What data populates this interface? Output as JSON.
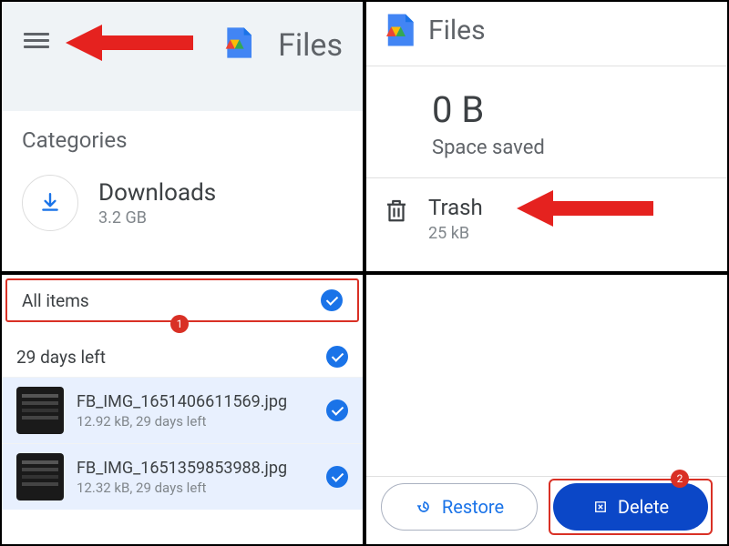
{
  "pane1": {
    "app_title": "Files",
    "categories_label": "Categories",
    "downloads": {
      "label": "Downloads",
      "size": "3.2 GB"
    }
  },
  "pane2": {
    "app_title": "Files",
    "space_value": "0 B",
    "space_label": "Space saved",
    "trash": {
      "label": "Trash",
      "size": "25 kB"
    }
  },
  "pane3": {
    "all_items_label": "All items",
    "days_left_label": "29 days left",
    "step_badge": "1",
    "files": [
      {
        "name": "FB_IMG_1651406611569.jpg",
        "meta": "12.92 kB, 29 days left"
      },
      {
        "name": "FB_IMG_1651359853988.jpg",
        "meta": "12.32 kB, 29 days left"
      }
    ]
  },
  "pane4": {
    "restore_label": "Restore",
    "delete_label": "Delete",
    "step_badge": "2"
  }
}
